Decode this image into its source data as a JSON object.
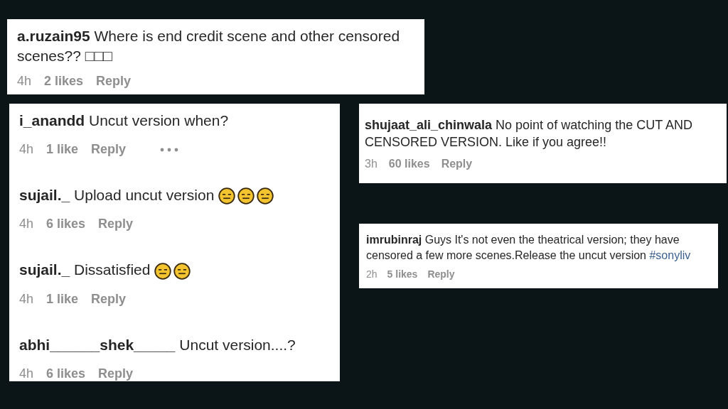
{
  "cards": [
    {
      "comments": [
        {
          "user": "a.ruzain95",
          "text": "Where is end credit scene and other censored scenes?? □□□",
          "time": "4h",
          "likes": "2 likes",
          "reply": "Reply",
          "more": false
        }
      ]
    },
    {
      "comments": [
        {
          "user": "i_anandd",
          "text": "Uncut version when?",
          "time": "4h",
          "likes": "1 like",
          "reply": "Reply",
          "more": true
        },
        {
          "user": "sujail._",
          "text": "Upload uncut version",
          "time": "4h",
          "likes": "6 likes",
          "reply": "Reply",
          "more": false,
          "emojis": [
            {
              "kind": "expressionless"
            },
            {
              "kind": "expressionless"
            },
            {
              "kind": "expressionless"
            }
          ]
        },
        {
          "user": "sujail._",
          "text": "Dissatisfied",
          "time": "4h",
          "likes": "1 like",
          "reply": "Reply",
          "more": false,
          "emojis": [
            {
              "kind": "expressionless"
            },
            {
              "kind": "expressionless"
            }
          ]
        },
        {
          "user": "abhi______shek_____",
          "text": "Uncut version....?",
          "time": "4h",
          "likes": "6 likes",
          "reply": "Reply",
          "more": false
        }
      ]
    },
    {
      "comments": [
        {
          "user": "shujaat_ali_chinwala",
          "text": "No point of watching the CUT AND CENSORED VERSION. Like if you agree!!",
          "time": "3h",
          "likes": "60 likes",
          "reply": "Reply",
          "more": false
        }
      ]
    },
    {
      "comments": [
        {
          "user": "imrubinraj",
          "text": "Guys It's not even the theatrical version; they have censored a few more scenes.Release the uncut version",
          "hashtag": "#sonyliv",
          "time": "2h",
          "likes": "5 likes",
          "reply": "Reply",
          "more": false
        }
      ]
    }
  ]
}
